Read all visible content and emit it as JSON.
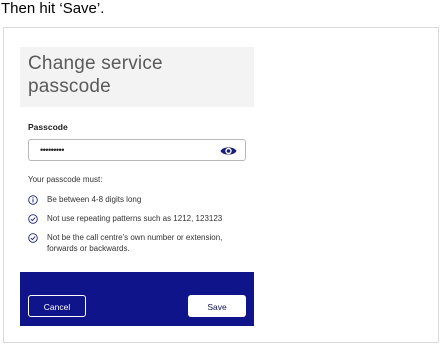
{
  "instruction": "Then hit ‘Save’.",
  "dialog": {
    "title": "Change service passcode",
    "passcode_label": "Passcode",
    "passcode_value": "•••••••••",
    "show_password_icon": "eye-icon",
    "rules_heading": "Your passcode must:",
    "rules": [
      {
        "icon": "info-circle-icon",
        "text": "Be between 4-8 digits long"
      },
      {
        "icon": "check-circle-icon",
        "text": "Not use repeating patterns such as 1212, 123123"
      },
      {
        "icon": "check-circle-icon",
        "text": "Not be the call centre's own number or extension, forwards or backwards."
      }
    ],
    "cancel_label": "Cancel",
    "save_label": "Save"
  },
  "colors": {
    "footer": "#10148a",
    "header": "#f3f3f3",
    "icon": "#1a1f7a"
  }
}
